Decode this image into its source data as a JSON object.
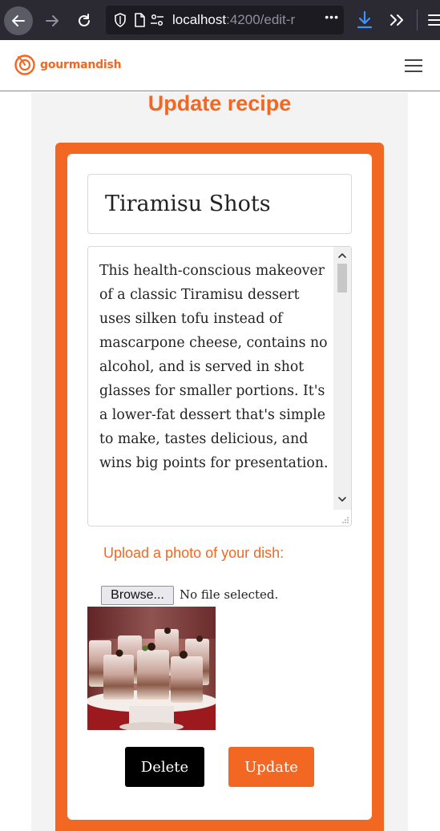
{
  "browser": {
    "url_host": "localhost",
    "url_rest": ":4200/edit-r",
    "more_label": "•••"
  },
  "header": {
    "brand": "gourmandish",
    "brand_color": "#f26722"
  },
  "form": {
    "heading": "Update recipe",
    "title_value": "Tiramisu Shots",
    "description_value": "This health-conscious makeover of a classic Tiramisu dessert uses silken tofu instead of mascarpone cheese, contains no alcohol, and is served in shot glasses for smaller portions. It's a lower-fat dessert that's simple to make, tastes delicious, and wins big points for presentation.",
    "upload_label": "Upload a photo of your dish:",
    "browse_label": "Browse...",
    "file_status": "No file selected.",
    "delete_label": "Delete",
    "update_label": "Update"
  },
  "icons": {
    "back": "arrow-left-icon",
    "forward": "arrow-right-icon",
    "reload": "reload-icon",
    "shield": "shield-icon",
    "page": "page-icon",
    "permissions": "permissions-icon",
    "download": "download-icon",
    "overflow": "chevrons-right-icon",
    "menu": "hamburger-icon"
  }
}
